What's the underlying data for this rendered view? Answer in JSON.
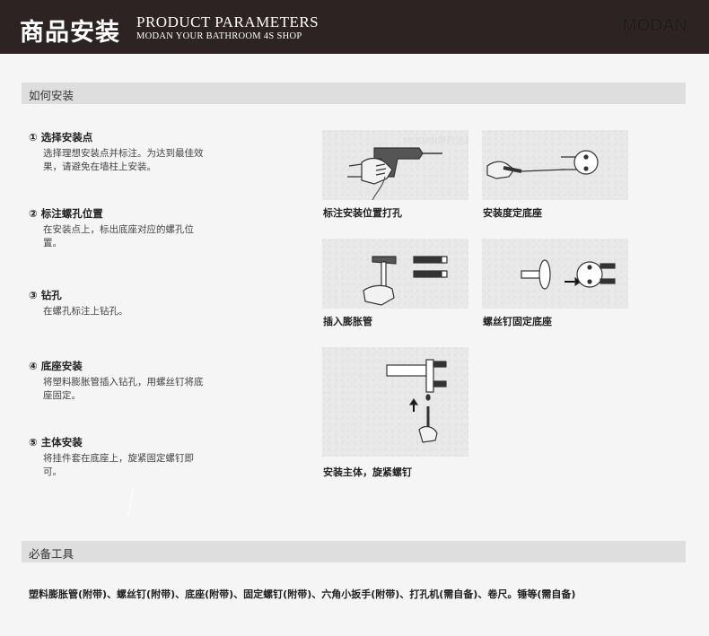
{
  "header": {
    "cn_title": "商品安装",
    "en_title": "PRODUCT PARAMETERS",
    "en_subtitle": "MODAN YOUR BATHROOM 4S SHOP",
    "brand": "MODAN"
  },
  "install_section": {
    "title": "如何安装",
    "steps": [
      {
        "title": "① 选择安装点",
        "desc": "选择理想安装点并标注。为达到最佳效果，请避免在墙柱上安装。"
      },
      {
        "title": "② 标注螺孔位置",
        "desc": "在安装点上，标出底座对应的螺孔位置。"
      },
      {
        "title": "③ 钻孔",
        "desc": "在螺孔标注上钻孔。"
      },
      {
        "title": "④ 底座安装",
        "desc": "将塑料膨胀管插入钻孔，用螺丝钉将底座固定。"
      },
      {
        "title": "⑤ 主体安装",
        "desc": "将挂件套在底座上，旋紧固定螺钉即可。"
      }
    ],
    "captions": [
      "标注安装位置打孔",
      "安装度定底座",
      "插入膨胀管",
      "螺丝钉固定底座",
      "安装主体，旋紧螺钉"
    ],
    "watermark": "MODAN摩丹洁具"
  },
  "tools_section": {
    "title": "必备工具",
    "text": "塑料膨胀管(附带)、螺丝钉(附带)、底座(附带)、固定螺钉(附带)、六角小扳手(附带)、打孔机(需自备)、卷尺。锤等(需自备)"
  }
}
